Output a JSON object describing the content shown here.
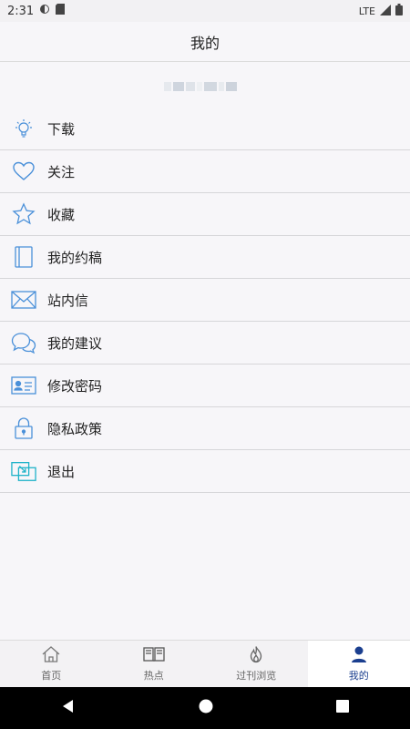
{
  "status": {
    "time": "2:31",
    "network": "LTE"
  },
  "header": {
    "title": "我的"
  },
  "menu": {
    "items": [
      {
        "label": "下载",
        "icon": "lightbulb-icon"
      },
      {
        "label": "关注",
        "icon": "heart-icon"
      },
      {
        "label": "收藏",
        "icon": "star-icon"
      },
      {
        "label": "我的约稿",
        "icon": "notebook-icon"
      },
      {
        "label": "站内信",
        "icon": "mail-icon"
      },
      {
        "label": "我的建议",
        "icon": "chat-bubbles-icon"
      },
      {
        "label": "修改密码",
        "icon": "id-card-icon"
      },
      {
        "label": "隐私政策",
        "icon": "lock-icon"
      },
      {
        "label": "退出",
        "icon": "exit-screen-icon"
      }
    ]
  },
  "tabs": [
    {
      "label": "首页",
      "icon": "home-icon",
      "active": false
    },
    {
      "label": "热点",
      "icon": "book-icon",
      "active": false
    },
    {
      "label": "过刊浏览",
      "icon": "flame-icon",
      "active": false
    },
    {
      "label": "我的",
      "icon": "person-icon",
      "active": true
    }
  ],
  "colors": {
    "accent": "#1b3f8f",
    "icon_blue": "#4a90d9",
    "icon_cyan": "#1fb3c9"
  }
}
